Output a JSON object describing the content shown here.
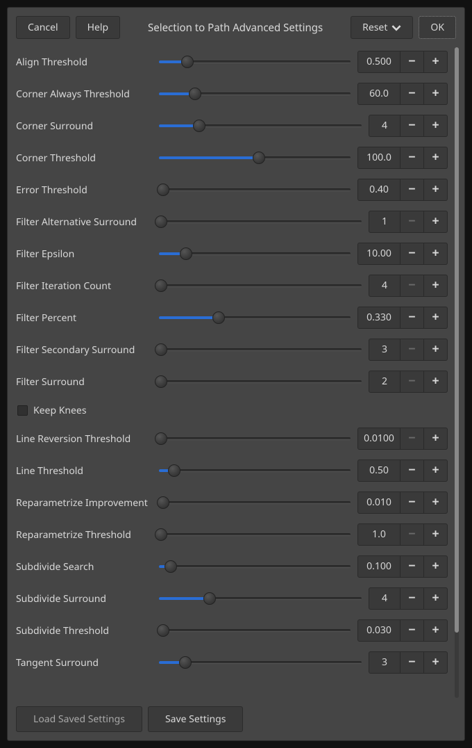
{
  "header": {
    "cancel": "Cancel",
    "help": "Help",
    "title": "Selection to Path Advanced Settings",
    "reset": "Reset",
    "ok": "OK"
  },
  "params": [
    {
      "label": "Align Threshold",
      "value": "0.500",
      "pos": 15,
      "minus_disabled": false,
      "narrow": false
    },
    {
      "label": "Corner Always Threshold",
      "value": "60.0",
      "pos": 19,
      "minus_disabled": false,
      "narrow": false
    },
    {
      "label": "Corner Surround",
      "value": "4",
      "pos": 20,
      "minus_disabled": false,
      "narrow": true
    },
    {
      "label": "Corner Threshold",
      "value": "100.0",
      "pos": 52,
      "minus_disabled": false,
      "narrow": false
    },
    {
      "label": "Error Threshold",
      "value": "0.40",
      "pos": 2,
      "minus_disabled": false,
      "narrow": false
    },
    {
      "label": "Filter Alternative Surround",
      "value": "1",
      "pos": 1,
      "minus_disabled": true,
      "narrow": true
    },
    {
      "label": "Filter Epsilon",
      "value": "10.00",
      "pos": 14,
      "minus_disabled": false,
      "narrow": false
    },
    {
      "label": "Filter Iteration Count",
      "value": "4",
      "pos": 1,
      "minus_disabled": true,
      "narrow": true
    },
    {
      "label": "Filter Percent",
      "value": "0.330",
      "pos": 31,
      "minus_disabled": false,
      "narrow": false
    },
    {
      "label": "Filter Secondary Surround",
      "value": "3",
      "pos": 1,
      "minus_disabled": true,
      "narrow": true
    },
    {
      "label": "Filter Surround",
      "value": "2",
      "pos": 1,
      "minus_disabled": true,
      "narrow": true
    },
    {
      "label": "Line Reversion Threshold",
      "value": "0.0100",
      "pos": 1,
      "minus_disabled": true,
      "narrow": false
    },
    {
      "label": "Line Threshold",
      "value": "0.50",
      "pos": 8,
      "minus_disabled": false,
      "narrow": false
    },
    {
      "label": "Reparametrize Improvement",
      "value": "0.010",
      "pos": 2,
      "minus_disabled": false,
      "narrow": false
    },
    {
      "label": "Reparametrize Threshold",
      "value": "1.0",
      "pos": 1,
      "minus_disabled": true,
      "narrow": false
    },
    {
      "label": "Subdivide Search",
      "value": "0.100",
      "pos": 6,
      "minus_disabled": false,
      "narrow": false
    },
    {
      "label": "Subdivide Surround",
      "value": "4",
      "pos": 25,
      "minus_disabled": false,
      "narrow": true
    },
    {
      "label": "Subdivide Threshold",
      "value": "0.030",
      "pos": 2,
      "minus_disabled": false,
      "narrow": false
    },
    {
      "label": "Tangent Surround",
      "value": "3",
      "pos": 13,
      "minus_disabled": false,
      "narrow": true
    }
  ],
  "checkbox": {
    "keep_knees": "Keep Knees",
    "checked": false
  },
  "footer": {
    "load": "Load Saved Settings",
    "save": "Save Settings"
  }
}
